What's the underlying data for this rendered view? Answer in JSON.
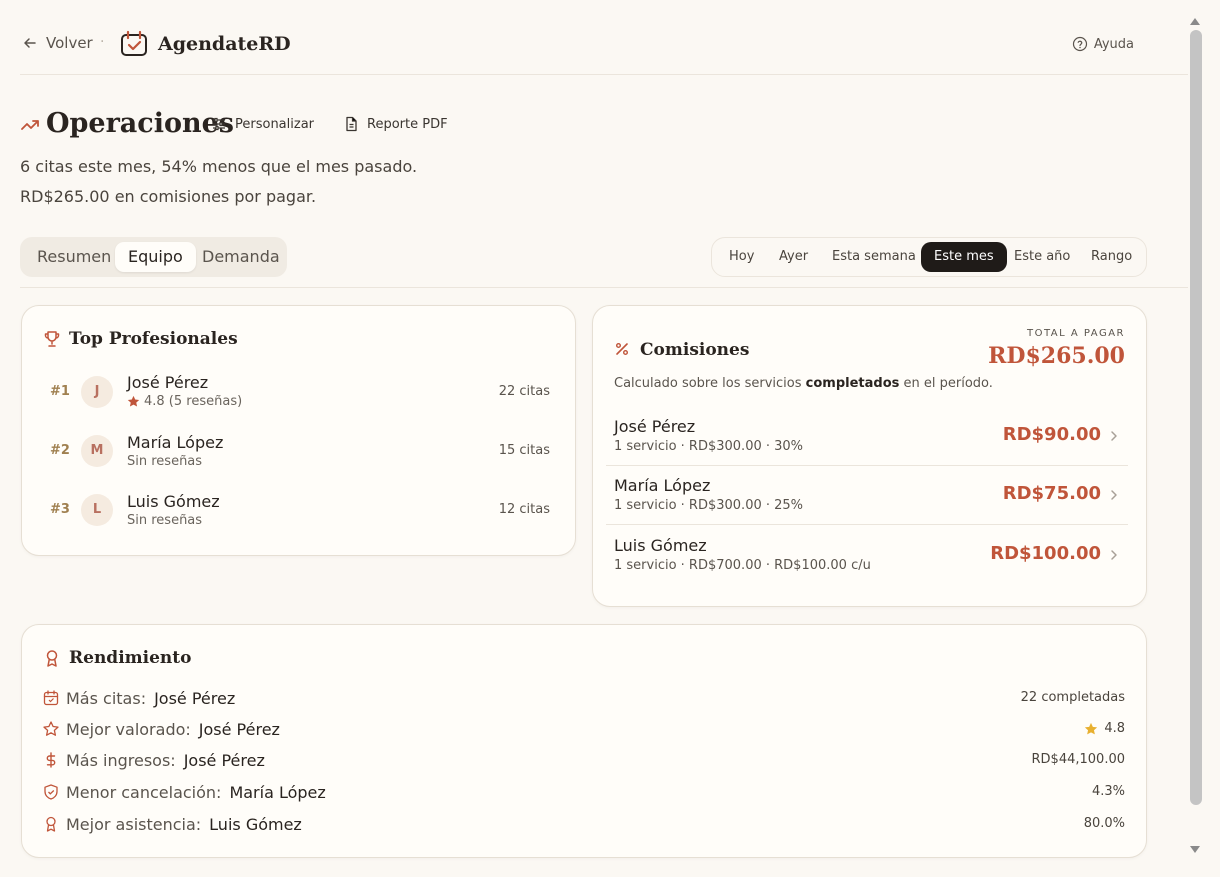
{
  "header": {
    "back_label": "Volver",
    "separator": "·",
    "brand_name": "AgendateRD",
    "help_label": "Ayuda"
  },
  "page": {
    "title": "Operaciones",
    "customize_label": "Personalizar",
    "report_label": "Reporte PDF",
    "summary_line1": "6 citas este mes, 54% menos que el mes pasado.",
    "summary_line2": "RD$265.00 en comisiones por pagar."
  },
  "tabs": [
    {
      "label": "Resumen",
      "active": false
    },
    {
      "label": "Equipo",
      "active": true
    },
    {
      "label": "Demanda",
      "active": false
    }
  ],
  "periods": [
    {
      "label": "Hoy",
      "active": false
    },
    {
      "label": "Ayer",
      "active": false
    },
    {
      "label": "Esta semana",
      "active": false
    },
    {
      "label": "Este mes",
      "active": true
    },
    {
      "label": "Este año",
      "active": false
    },
    {
      "label": "Rango",
      "active": false
    }
  ],
  "top_professionals": {
    "title": "Top Profesionales",
    "items": [
      {
        "rank": "#1",
        "initial": "J",
        "name": "José Pérez",
        "meta": "4.8 (5 reseñas)",
        "count": "22 citas"
      },
      {
        "rank": "#2",
        "initial": "M",
        "name": "María López",
        "meta": "Sin reseñas",
        "count": "15 citas"
      },
      {
        "rank": "#3",
        "initial": "L",
        "name": "Luis Gómez",
        "meta": "Sin reseñas",
        "count": "12 citas"
      }
    ]
  },
  "commissions": {
    "title": "Comisiones",
    "total_label": "TOTAL A PAGAR",
    "total_value": "RD$265.00",
    "note_prefix": "Calculado sobre los servicios ",
    "note_bold": "completados",
    "note_suffix": " en el período.",
    "items": [
      {
        "name": "José Pérez",
        "meta": "1 servicio · RD$300.00 · 30%",
        "amount": "RD$90.00"
      },
      {
        "name": "María López",
        "meta": "1 servicio · RD$300.00 · 25%",
        "amount": "RD$75.00"
      },
      {
        "name": "Luis Gómez",
        "meta": "1 servicio · RD$700.00 · RD$100.00 c/u",
        "amount": "RD$100.00"
      }
    ]
  },
  "performance": {
    "title": "Rendimiento",
    "items": [
      {
        "icon": "calendar-icon",
        "label": "Más citas:",
        "name": "José Pérez",
        "value": "22 completadas"
      },
      {
        "icon": "star-icon",
        "label": "Mejor valorado:",
        "name": "José Pérez",
        "value": "4.8"
      },
      {
        "icon": "dollar-icon",
        "label": "Más ingresos:",
        "name": "José Pérez",
        "value": "RD$44,100.00"
      },
      {
        "icon": "shield-icon",
        "label": "Menor cancelación:",
        "name": "María López",
        "value": "4.3%"
      },
      {
        "icon": "award-icon",
        "label": "Mejor asistencia:",
        "name": "Luis Gómez",
        "value": "80.0%"
      }
    ]
  },
  "colors": {
    "accent": "#c0553a",
    "background": "#fbf8f3",
    "active_period": "#1f1b18",
    "star": "#e8b030"
  }
}
